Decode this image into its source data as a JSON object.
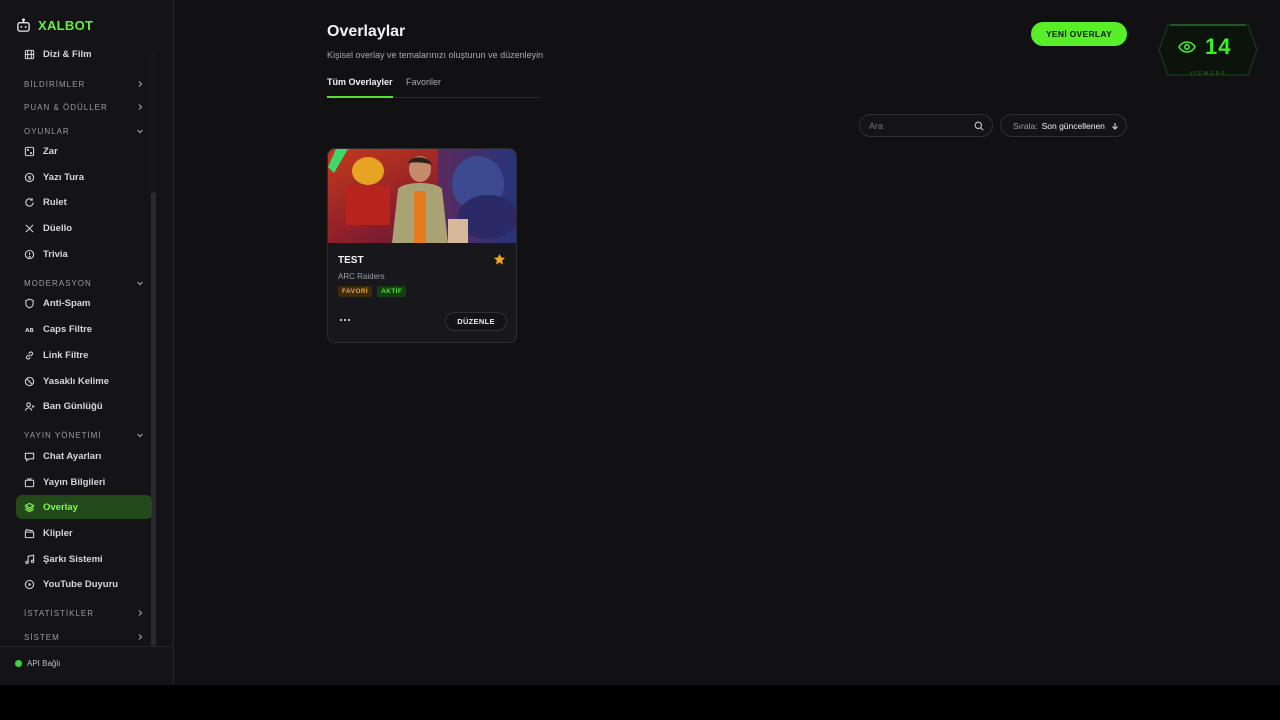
{
  "brand": {
    "name": "XALBOT"
  },
  "sidebar": {
    "items": [
      {
        "key": "dizi",
        "label": "Dizi & Film",
        "icon": "film-icon"
      },
      {
        "key": "zar",
        "label": "Zar",
        "icon": "dice-icon"
      },
      {
        "key": "yazi-tura",
        "label": "Yazı Tura",
        "icon": "coin-icon"
      },
      {
        "key": "rulet",
        "label": "Rulet",
        "icon": "refresh-icon"
      },
      {
        "key": "duello",
        "label": "Düello",
        "icon": "swords-icon"
      },
      {
        "key": "trivia",
        "label": "Trivia",
        "icon": "globe-icon"
      },
      {
        "key": "anti-spam",
        "label": "Anti-Spam",
        "icon": "shield-icon"
      },
      {
        "key": "caps",
        "label": "Caps Filtre",
        "icon": "caps-icon"
      },
      {
        "key": "link",
        "label": "Link Filtre",
        "icon": "link-icon"
      },
      {
        "key": "yasakli",
        "label": "Yasaklı Kelime",
        "icon": "ban-icon"
      },
      {
        "key": "ban",
        "label": "Ban Günlüğü",
        "icon": "user-x-icon"
      },
      {
        "key": "chat",
        "label": "Chat Ayarları",
        "icon": "chat-icon"
      },
      {
        "key": "yayin",
        "label": "Yayın Bilgileri",
        "icon": "tv-icon"
      },
      {
        "key": "overlay",
        "label": "Overlay",
        "icon": "layers-icon"
      },
      {
        "key": "klipler",
        "label": "Klipler",
        "icon": "clapper-icon"
      },
      {
        "key": "sarki",
        "label": "Şarkı Sistemi",
        "icon": "music-icon"
      },
      {
        "key": "youtube",
        "label": "YouTube Duyuru",
        "icon": "play-circle-icon"
      }
    ],
    "sections": {
      "bildirimler": "BİLDİRİMLER",
      "puan": "PUAN & ÖDÜLLER",
      "oyunlar": "OYUNLAR",
      "moderasyon": "MODERASYON",
      "yayin_yonetimi": "YAYIN YÖNETİMİ",
      "istatistikler": "İSTATİSTİKLER",
      "sistem": "SİSTEM"
    },
    "active_item": "Overlay",
    "api_status": "API Bağlı"
  },
  "header": {
    "title": "Overlaylar",
    "subtitle": "Kişisel overlay ve temalarınızı oluşturun ve düzenleyin",
    "new_button": "YENİ OVERLAY"
  },
  "tabs": {
    "all": "Tüm Overlayler",
    "favorites": "Favoriler",
    "active": "Tüm Overlayler"
  },
  "viewers": {
    "count": "14",
    "label": "VIEWERS"
  },
  "search": {
    "placeholder": "Ara",
    "value": ""
  },
  "sort": {
    "label": "Sırala:",
    "value": "Son güncellenen"
  },
  "cards": [
    {
      "title": "TEST",
      "game": "ARC Raiders",
      "badges": [
        "FAVORİ",
        "AKTİF"
      ],
      "edit_label": "DÜZENLE",
      "favorite": true
    }
  ],
  "colors": {
    "accent": "#58ee2a",
    "background": "#111114",
    "sidebar": "#141417",
    "active_item": "#23481a",
    "star": "#f5a623"
  }
}
